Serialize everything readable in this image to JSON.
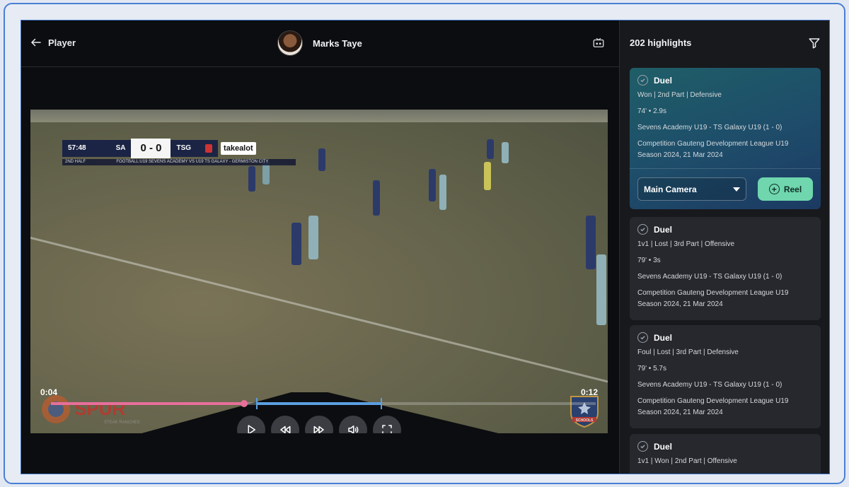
{
  "header": {
    "back_label": "Player",
    "player_name": "Marks Taye"
  },
  "video": {
    "current_time": "0:04",
    "end_time": "0:12",
    "progress_fraction": 0.35,
    "scoreboard": {
      "clock": "57:48",
      "home": "SA",
      "score": "0 - 0",
      "away": "TSG",
      "sponsor": "takealot",
      "period": "2ND HALF",
      "subtitle": "FOOTBALL:U19 SEVENS ACADEMY VS U19 TS GALAXY - GERMISTON CITY"
    },
    "watermark_brand": "SPUR",
    "watermark_sub": "STEAK RANCHES",
    "badge_text": "SCHOOLS"
  },
  "controls": [
    "play-icon",
    "rewind-icon",
    "fast-forward-icon",
    "volume-icon",
    "fullscreen-icon"
  ],
  "sidebar": {
    "title": "202 highlights",
    "cards": [
      {
        "title": "Duel",
        "tags": "Won | 2nd Part | Defensive",
        "time": "74' • 2.9s",
        "match": "Sevens Academy U19 - TS Galaxy U19 (1 - 0)",
        "competition": "Competition Gauteng Development League U19",
        "season": "Season 2024, 21 Mar 2024",
        "camera": "Main Camera",
        "reel_label": "Reel"
      },
      {
        "title": "Duel",
        "tags": "1v1 | Lost | 3rd Part | Offensive",
        "time": "79' • 3s",
        "match": "Sevens Academy U19 - TS Galaxy U19 (1 - 0)",
        "competition": "Competition Gauteng Development League U19",
        "season": "Season 2024, 21 Mar 2024"
      },
      {
        "title": "Duel",
        "tags": "Foul | Lost | 3rd Part | Defensive",
        "time": "79' • 5.7s",
        "match": "Sevens Academy U19 - TS Galaxy U19 (1 - 0)",
        "competition": "Competition Gauteng Development League U19",
        "season": "Season 2024, 21 Mar 2024"
      },
      {
        "title": "Duel",
        "tags": "1v1 | Won | 2nd Part | Offensive"
      }
    ]
  },
  "colors": {
    "accent_green": "#6fd6ae",
    "progress_played": "#e76f9b",
    "progress_segment": "#5b9ee0"
  }
}
